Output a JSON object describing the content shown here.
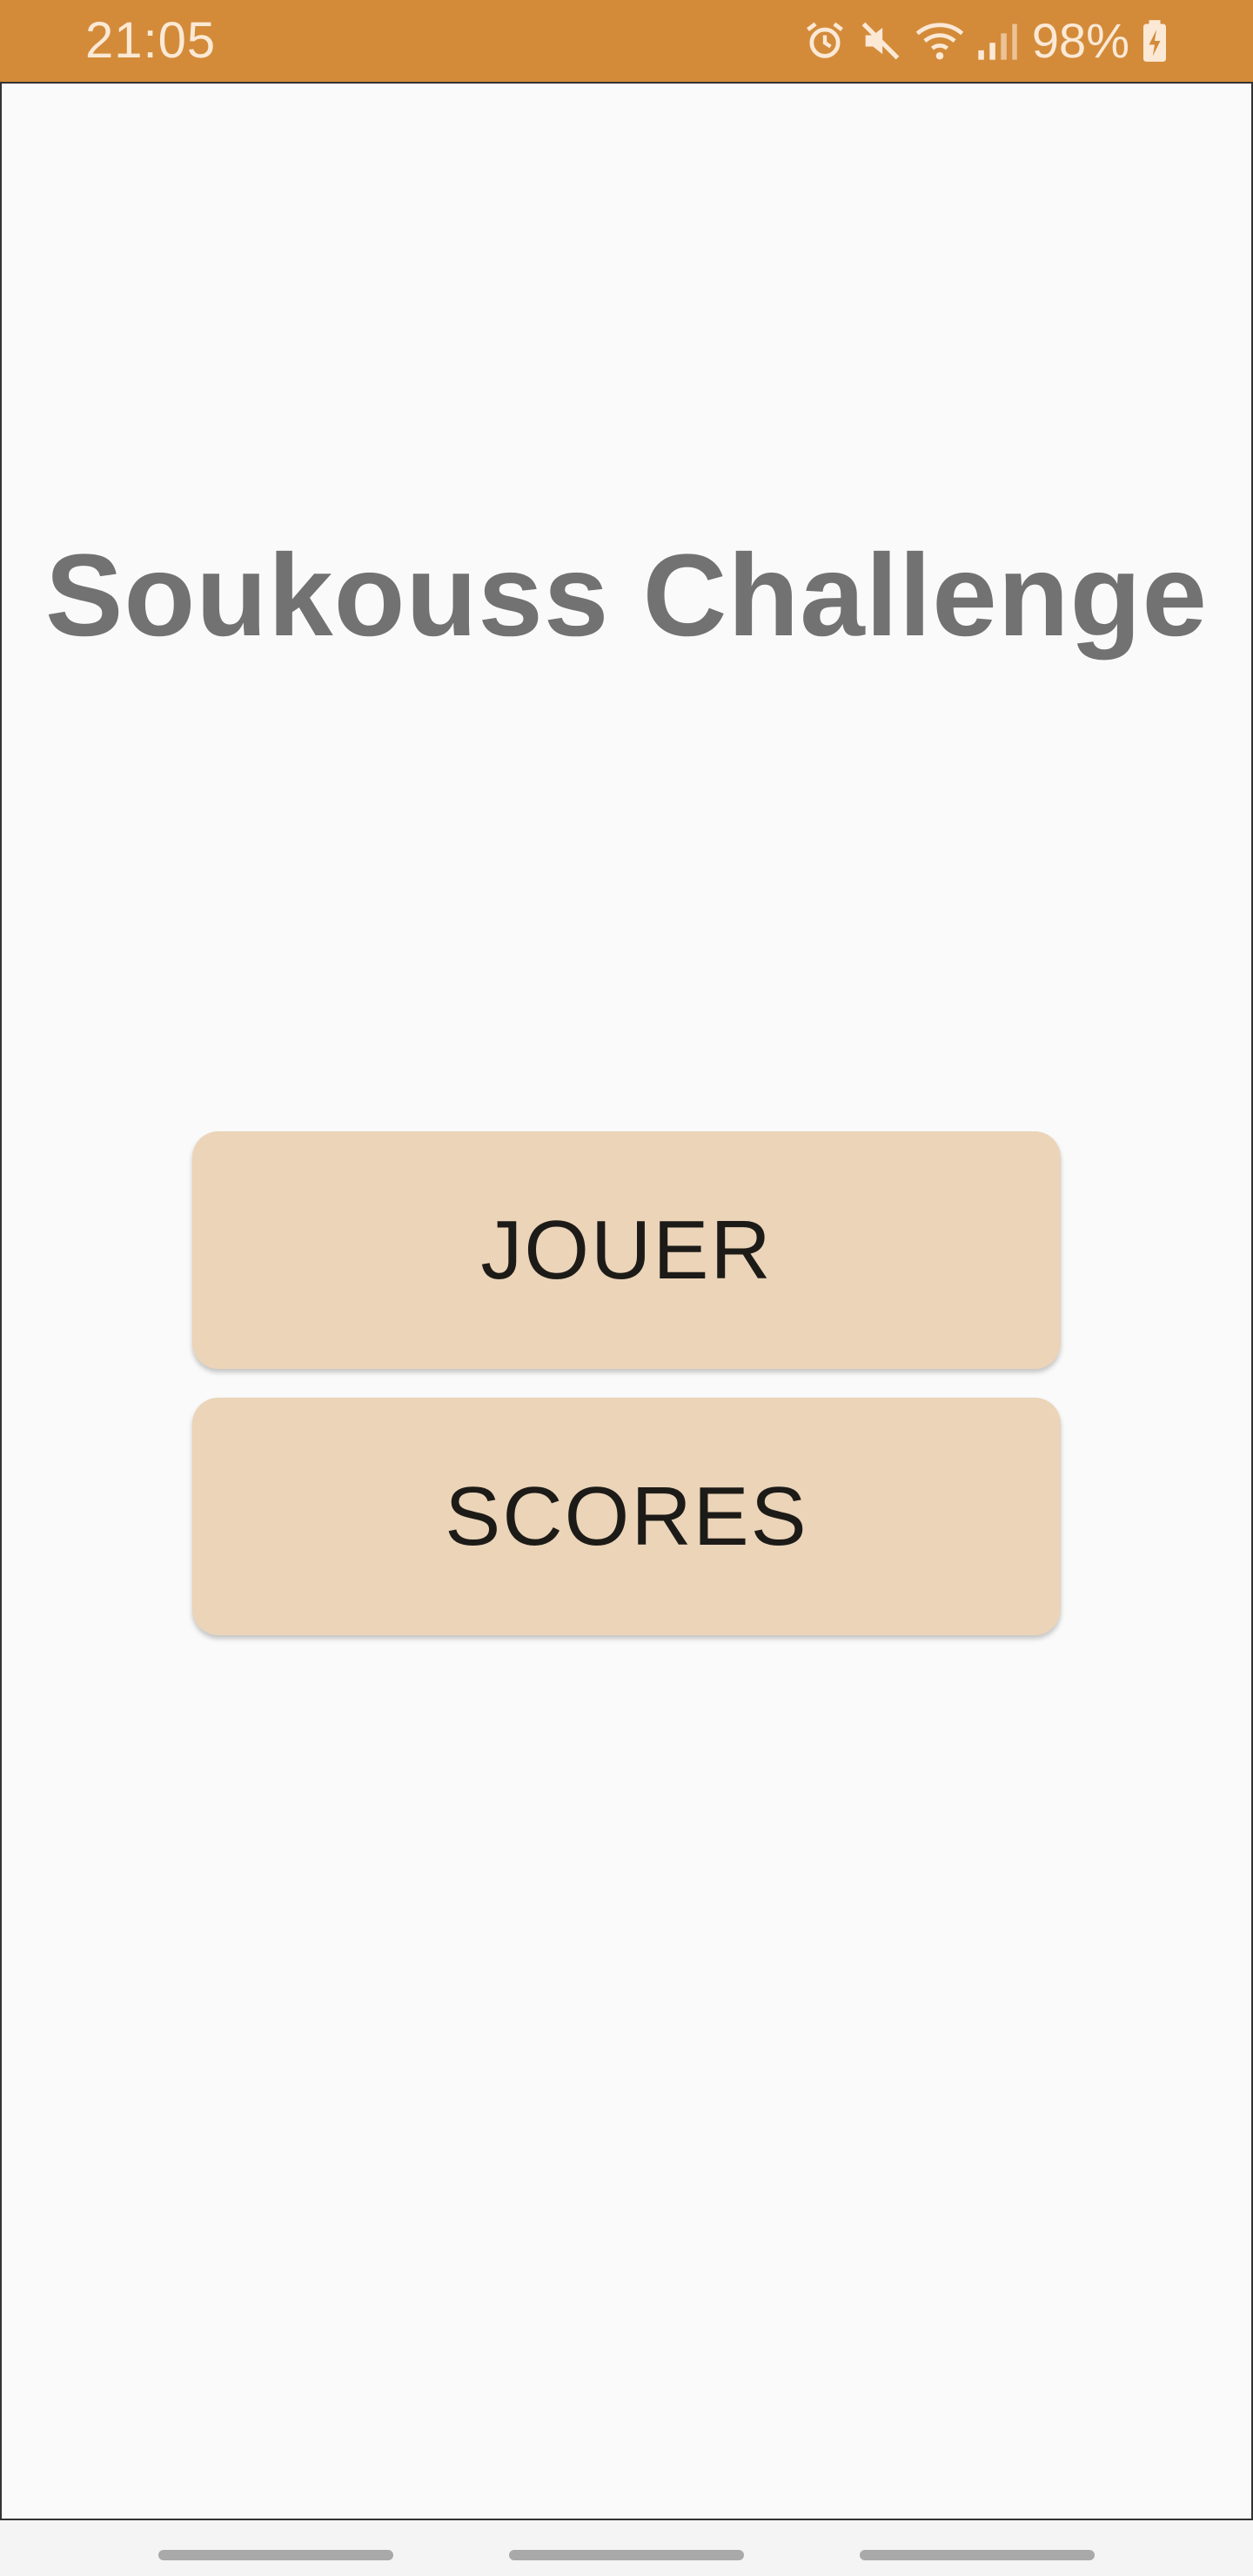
{
  "status_bar": {
    "time": "21:05",
    "battery": "98%",
    "icons": [
      "alarm-icon",
      "mute-icon",
      "wifi-icon",
      "signal-icon",
      "battery-charging-icon"
    ],
    "color": "#d38b3a"
  },
  "app": {
    "title": "Soukouss Challenge",
    "buttons": {
      "play": "JOUER",
      "scores": "SCORES"
    },
    "button_color": "#ebd4b8"
  },
  "nav_bar": {
    "items": [
      "nav-pill-left",
      "nav-pill-center",
      "nav-pill-right"
    ]
  }
}
